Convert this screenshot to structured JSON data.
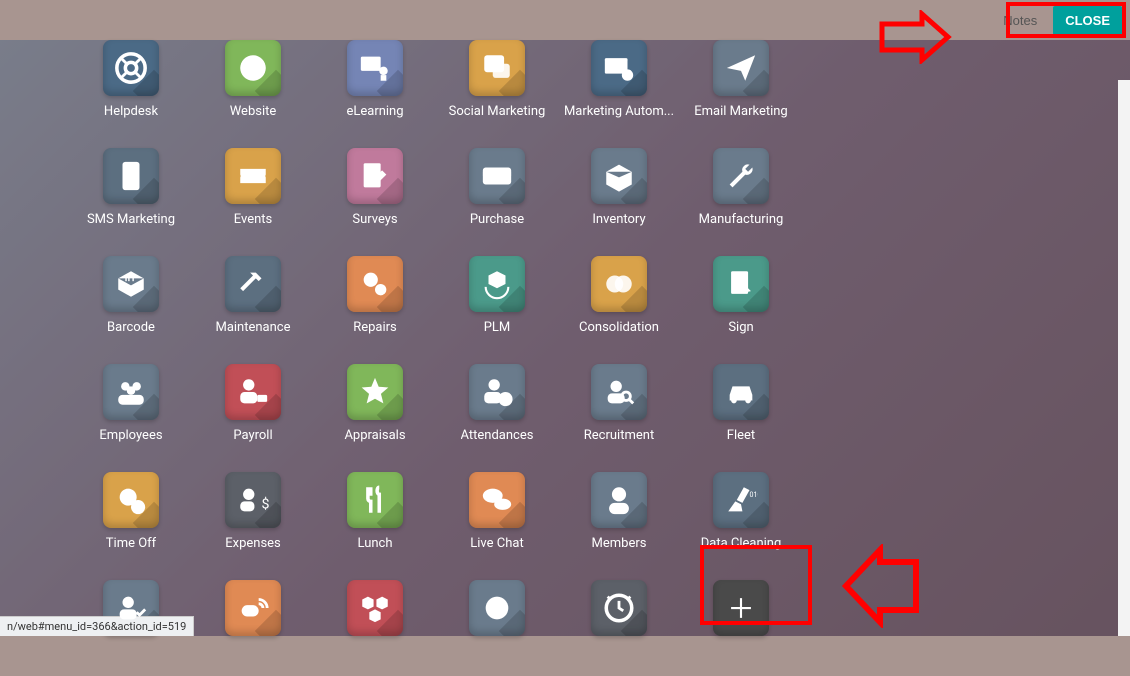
{
  "topbar": {
    "notes_label": "Notes",
    "close_label": "CLOSE"
  },
  "status_text": "n/web#menu_id=366&action_id=519",
  "apps": [
    {
      "label": "Helpdesk",
      "color": "#4b6a86",
      "icon": "lifebuoy"
    },
    {
      "label": "Website",
      "color": "#80b75a",
      "icon": "globe"
    },
    {
      "label": "eLearning",
      "color": "#7585b5",
      "icon": "teach"
    },
    {
      "label": "Social Marketing",
      "color": "#d9a24a",
      "icon": "chat"
    },
    {
      "label": "Marketing Autom...",
      "color": "#4b6a86",
      "icon": "envelope-gear"
    },
    {
      "label": "Email Marketing",
      "color": "#6a7b8c",
      "icon": "paper-plane"
    },
    {
      "label": "SMS Marketing",
      "color": "#5c6f80",
      "icon": "sms"
    },
    {
      "label": "Events",
      "color": "#d9a24a",
      "icon": "ticket"
    },
    {
      "label": "Surveys",
      "color": "#c07a9c",
      "icon": "clipboard-pencil"
    },
    {
      "label": "Purchase",
      "color": "#6a7b8c",
      "icon": "credit-card"
    },
    {
      "label": "Inventory",
      "color": "#6a7b8c",
      "icon": "box-open"
    },
    {
      "label": "Manufacturing",
      "color": "#6a7b8c",
      "icon": "wrench"
    },
    {
      "label": "Barcode",
      "color": "#6a7b8c",
      "icon": "barcode-box"
    },
    {
      "label": "Maintenance",
      "color": "#5c6f80",
      "icon": "hammer"
    },
    {
      "label": "Repairs",
      "color": "#e08a54",
      "icon": "gears"
    },
    {
      "label": "PLM",
      "color": "#4b9a8a",
      "icon": "cube-cycle"
    },
    {
      "label": "Consolidation",
      "color": "#d9a24a",
      "icon": "venn"
    },
    {
      "label": "Sign",
      "color": "#4b9a8a",
      "icon": "sign-doc"
    },
    {
      "label": "Employees",
      "color": "#6a7b8c",
      "icon": "group"
    },
    {
      "label": "Payroll",
      "color": "#c14f57",
      "icon": "money-person"
    },
    {
      "label": "Appraisals",
      "color": "#80b75a",
      "icon": "star"
    },
    {
      "label": "Attendances",
      "color": "#6a7b8c",
      "icon": "person-clock"
    },
    {
      "label": "Recruitment",
      "color": "#6a7b8c",
      "icon": "person-search"
    },
    {
      "label": "Fleet",
      "color": "#5c6f80",
      "icon": "car"
    },
    {
      "label": "Time Off",
      "color": "#d9a24a",
      "icon": "gear-clock"
    },
    {
      "label": "Expenses",
      "color": "#5c6068",
      "icon": "expense"
    },
    {
      "label": "Lunch",
      "color": "#80b75a",
      "icon": "utensils"
    },
    {
      "label": "Live Chat",
      "color": "#e08a54",
      "icon": "bubbles"
    },
    {
      "label": "Members",
      "color": "#6a7b8c",
      "icon": "member"
    },
    {
      "label": "Data Cleaning",
      "color": "#5c6f80",
      "icon": "broom"
    },
    {
      "label": "",
      "color": "#6a7b8c",
      "icon": "person-check"
    },
    {
      "label": "",
      "color": "#e08a54",
      "icon": "signal"
    },
    {
      "label": "",
      "color": "#c14f57",
      "icon": "boxes"
    },
    {
      "label": "",
      "color": "#6a7b8c",
      "icon": "cog"
    },
    {
      "label": "",
      "color": "#5c6068",
      "icon": "clock-alert"
    },
    {
      "label": "",
      "color": "#4a4a4a",
      "icon": "plus",
      "add": true
    }
  ]
}
